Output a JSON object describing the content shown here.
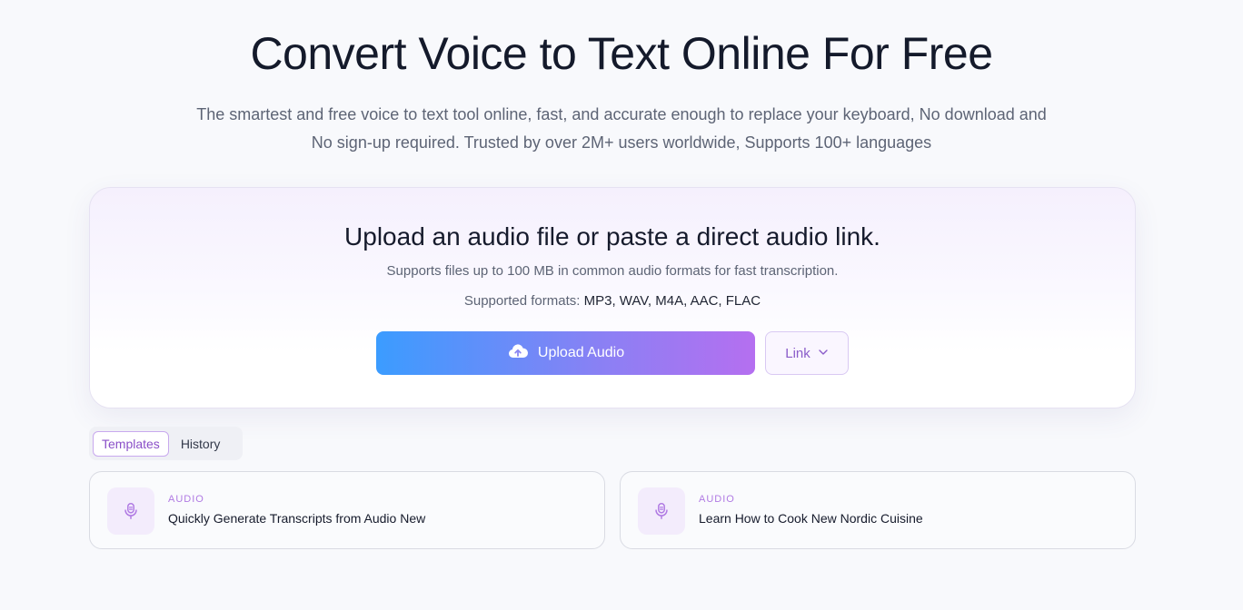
{
  "hero": {
    "title": "Convert Voice to Text Online For Free",
    "subtitle_line1": "The smartest and free voice to text tool online, fast, and accurate enough to replace your keyboard, No download and",
    "subtitle_line2": "No sign-up required. Trusted by over 2M+ users worldwide, Supports 100+ languages"
  },
  "upload": {
    "title": "Upload an audio file or paste a direct audio link.",
    "description": "Supports files up to 100 MB in common audio formats for fast transcription.",
    "formats_label": "Supported formats:",
    "formats": "MP3, WAV, M4A, AAC, FLAC",
    "upload_button": {
      "label": "Upload Audio",
      "icon": "cloud-upload-icon"
    },
    "link_button": {
      "label": "Link",
      "icon": "chevron-down-icon"
    }
  },
  "tabs": [
    {
      "label": "Templates",
      "active": true
    },
    {
      "label": "History",
      "active": false
    }
  ],
  "templates": [
    {
      "tag": "AUDIO",
      "title": "Quickly Generate Transcripts from Audio New",
      "icon": "microphone-icon"
    },
    {
      "tag": "AUDIO",
      "title": "Learn How to Cook New Nordic Cuisine",
      "icon": "microphone-icon"
    }
  ],
  "colors": {
    "background": "#f8f9fc",
    "accent_purple": "#8a4fc8",
    "gradient_start": "#3b9cff",
    "gradient_end": "#b56ff0"
  }
}
